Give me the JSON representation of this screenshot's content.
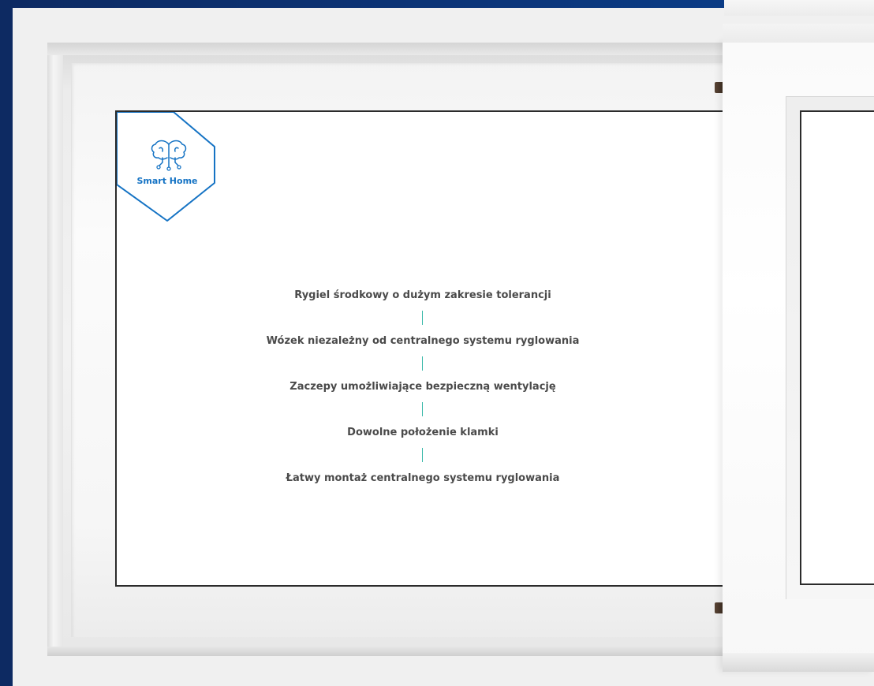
{
  "badge": {
    "label": "Smart Home",
    "icon": "brain-circuit-icon",
    "accent_color": "#1573c4"
  },
  "features": [
    {
      "text": "Rygiel środkowy o dużym zakresie tolerancji"
    },
    {
      "text": "Wózek niezależny od centralnego systemu ryglowania"
    },
    {
      "text": "Zaczepy umożliwiające bezpieczną wentylację"
    },
    {
      "text": "Dowolne położenie klamki"
    },
    {
      "text": "Łatwy montaż centralnego systemu ryglowania"
    }
  ],
  "colors": {
    "background": "#0b3477",
    "divider": "#36b8a8",
    "text": "#4a4a4a"
  }
}
